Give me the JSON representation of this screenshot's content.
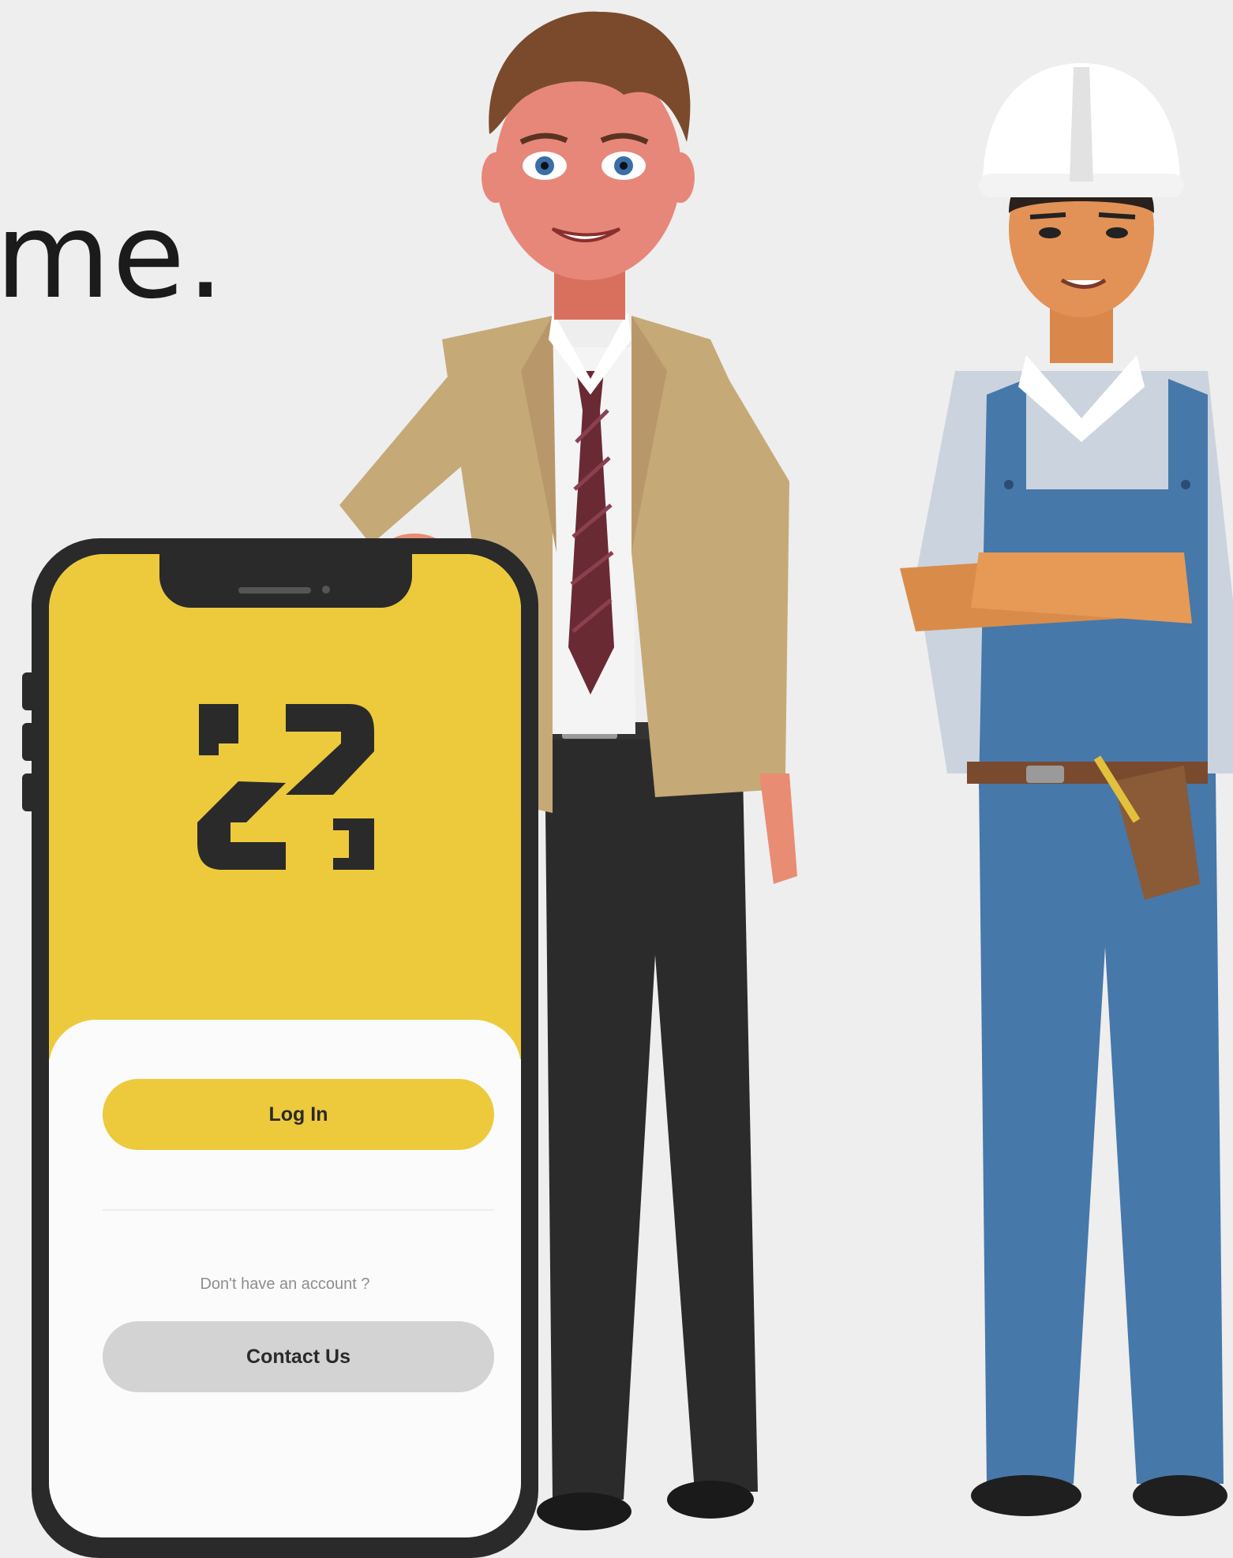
{
  "headline": "me.",
  "phone": {
    "login_button": "Log In",
    "account_prompt": "Don't have an account ?",
    "contact_button": "Contact Us"
  },
  "colors": {
    "background": "#eeeeee",
    "brand_yellow": "#ecca3c",
    "phone_body": "#2a2a2a",
    "contact_button": "#d3d3d3"
  },
  "icons": [
    "app-logo-icon"
  ]
}
